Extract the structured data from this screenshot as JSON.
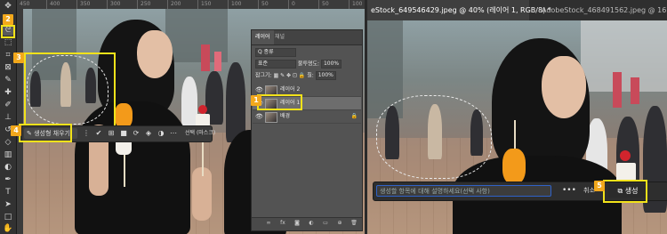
{
  "left_window": {
    "ruler_marks": [
      "450",
      "400",
      "350",
      "300",
      "250",
      "200",
      "150",
      "100",
      "50",
      "0",
      "50",
      "100"
    ],
    "toolbar_icons": [
      "move-icon",
      "artboard-icon",
      "lasso-icon",
      "object-select-icon",
      "crop-icon",
      "frame-icon",
      "eyedropper-icon",
      "spot-heal-icon",
      "brush-icon",
      "stamp-icon",
      "history-brush-icon",
      "eraser-icon",
      "gradient-icon",
      "blur-icon",
      "dodge-icon",
      "pen-icon",
      "type-icon",
      "path-select-icon",
      "rectangle-icon",
      "hand-icon"
    ],
    "contextual_bar": {
      "generative_fill_label": "생성형 채우기",
      "select_mask_label": "선택 (마스크)"
    }
  },
  "layers_panel": {
    "tab_layers": "레이어",
    "tab_channels": "채널",
    "search_value": "Q 종류",
    "blend_mode": "표준",
    "opacity_label": "불투명도:",
    "opacity_value": "100%",
    "lock_label": "잠그기:",
    "fill_label": "칠:",
    "fill_value": "100%",
    "layers": [
      {
        "name": "레이어 2",
        "selected": false,
        "visible": true,
        "locked": false
      },
      {
        "name": "레이어 1",
        "selected": true,
        "visible": true,
        "locked": false
      },
      {
        "name": "배경",
        "selected": false,
        "visible": true,
        "locked": true
      }
    ],
    "bottom_icons": [
      "link-icon",
      "fx-icon",
      "mask-icon",
      "adjustment-icon",
      "group-icon",
      "new-layer-icon",
      "trash-icon"
    ],
    "bottom_labels": [
      "∞",
      "fx"
    ]
  },
  "right_window": {
    "tabs": [
      {
        "label": "eStock_649546429.jpeg @ 40% (레이어 1, RGB/8) *",
        "active": true
      },
      {
        "label": "AdobeStock_468491562.jpeg @ 16.7% (R",
        "active": false
      }
    ],
    "contextual_bar": {
      "prompt_placeholder": "생성할 항목에 대해 설명하세요(선택 사항)",
      "more_label": "•••",
      "cancel_label": "취소",
      "generate_label": "생성"
    }
  },
  "annotations": {
    "badges": [
      "1",
      "2",
      "3",
      "4",
      "5"
    ],
    "highlight_color": "#f2e21a",
    "badge_color": "#f2a81c"
  }
}
